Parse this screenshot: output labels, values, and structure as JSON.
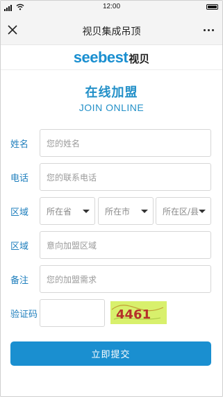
{
  "status_bar": {
    "time": "12:00"
  },
  "title_bar": {
    "title": "视贝集成吊顶"
  },
  "logo": {
    "main": "seebest",
    "cn": "视贝"
  },
  "heading": {
    "cn": "在线加盟",
    "en": "JOIN ONLINE"
  },
  "form": {
    "name": {
      "label": "姓名",
      "placeholder": "您的姓名"
    },
    "phone": {
      "label": "电话",
      "placeholder": "您的联系电话"
    },
    "region": {
      "label": "区域",
      "province": "所在省",
      "city": "所在市",
      "district": "所在区/县"
    },
    "target_region": {
      "label": "区域",
      "placeholder": "意向加盟区域"
    },
    "remark": {
      "label": "备注",
      "placeholder": "您的加盟需求"
    },
    "captcha": {
      "label": "验证码",
      "code": "4461"
    },
    "submit_label": "立即提交"
  },
  "colors": {
    "brand": "#1a8fd0",
    "label": "#1f7fbd",
    "captcha_bg": "#d8f06c",
    "captcha_text": "#b5302a"
  }
}
